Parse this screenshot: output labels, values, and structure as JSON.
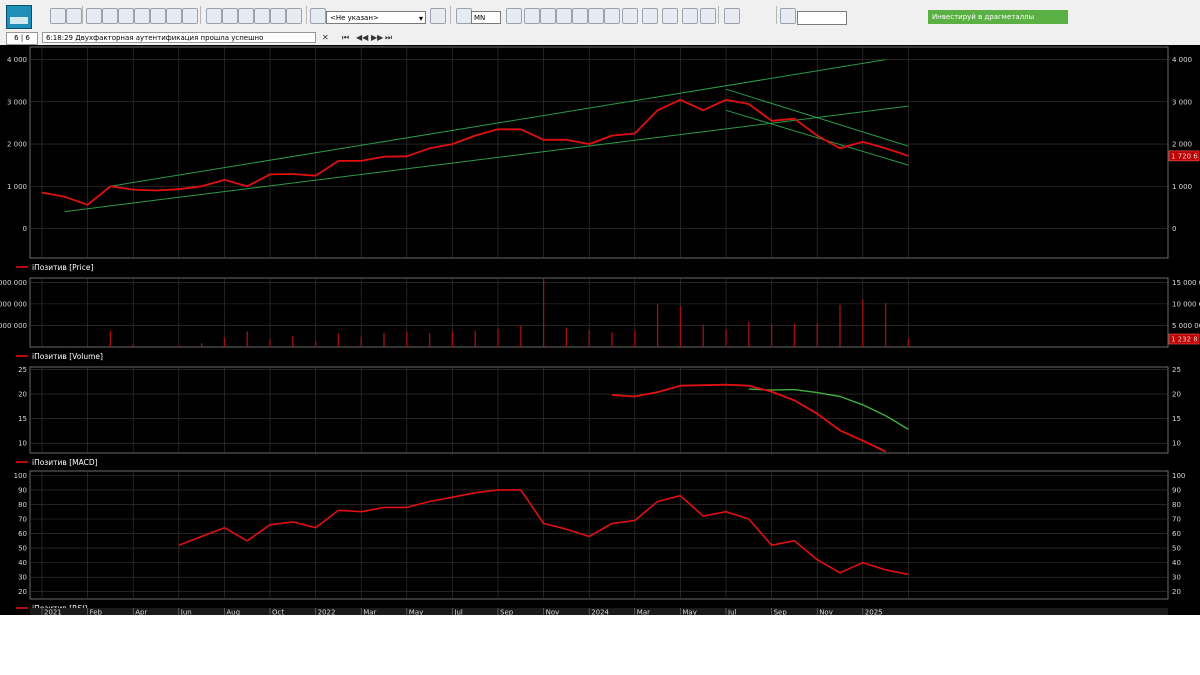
{
  "toolbar": {
    "strategy_value": "<Не указан>",
    "timeframe_value": "MN",
    "promo_label": "Инвестируй в драгметаллы"
  },
  "status": {
    "counter": "6 | 6",
    "time": "6:18:29",
    "message": "Двухфакторная аутентификация прошла успешно"
  },
  "icons": [
    "app-logo-icon",
    "cursor-icon",
    "crosshair-icon",
    "zoom-icon",
    "magnet-icon",
    "trend-line-icon",
    "text-icon",
    "search-icon"
  ],
  "colors": {
    "price": "#e01010",
    "signal": "#40b040",
    "trend": "#2a9a4a",
    "grid": "#3a3a3a",
    "label_bg": "#c00000"
  },
  "chart_data": [
    {
      "type": "line",
      "pane": "price",
      "legend": "iПозитив [Price]",
      "yticks": [
        "0",
        "1 000",
        "2 000",
        "3 000",
        "4 000"
      ],
      "ylim": [
        -700,
        4300
      ],
      "last_value_label": "1 720 6",
      "x": [
        0,
        1,
        2,
        3,
        4,
        5,
        6,
        7,
        8,
        9,
        10,
        11,
        12,
        13,
        14,
        15,
        16,
        17,
        18,
        19,
        20,
        21,
        22,
        23,
        24,
        25,
        26,
        27,
        28,
        29,
        30,
        31,
        32,
        33,
        34,
        35,
        36,
        37,
        38
      ],
      "values": [
        850,
        750,
        560,
        1000,
        920,
        900,
        930,
        1000,
        1150,
        1000,
        1280,
        1290,
        1250,
        1600,
        1600,
        1700,
        1710,
        1900,
        2000,
        2200,
        2350,
        2350,
        2100,
        2100,
        2000,
        2200,
        2250,
        2800,
        3050,
        2800,
        3050,
        2950,
        2550,
        2600,
        2200,
        1900,
        2050,
        1900,
        1720
      ],
      "trendlines": [
        {
          "from": [
            3,
            1000
          ],
          "to": [
            37,
            4000
          ]
        },
        {
          "from": [
            1,
            400
          ],
          "to": [
            38,
            2900
          ]
        },
        {
          "from": [
            30,
            3300
          ],
          "to": [
            38,
            1950
          ]
        },
        {
          "from": [
            30,
            2800
          ],
          "to": [
            38,
            1500
          ]
        }
      ]
    },
    {
      "type": "bar",
      "pane": "volume",
      "legend": "iПозитив [Volume]",
      "yticks_left": [
        "000 000",
        "000 000",
        "000 000"
      ],
      "yticks_right": [
        "5 000 00",
        "10 000 0",
        "15 000 0"
      ],
      "ylim": [
        0,
        16000000
      ],
      "last_value_label": "1 232 8",
      "x": [
        0,
        1,
        2,
        3,
        4,
        5,
        6,
        7,
        8,
        9,
        10,
        11,
        12,
        13,
        14,
        15,
        16,
        17,
        18,
        19,
        20,
        21,
        22,
        23,
        24,
        25,
        26,
        27,
        28,
        29,
        30,
        31,
        32,
        33,
        34,
        35,
        36,
        37,
        38
      ],
      "values": [
        200000,
        100000,
        300000,
        3800000,
        600000,
        200000,
        300000,
        900000,
        2200000,
        3600000,
        1800000,
        2600000,
        1400000,
        3200000,
        2400000,
        3300000,
        3500000,
        3200000,
        3600000,
        3800000,
        4200000,
        5000000,
        16000000,
        4500000,
        3900000,
        3400000,
        3800000,
        10000000,
        9500000,
        5200000,
        4000000,
        5800000,
        5200000,
        5400000,
        5500000,
        9800000,
        11000000,
        10200000,
        2000000
      ]
    },
    {
      "type": "line",
      "pane": "macd",
      "legend": "iПозитив [MACD]",
      "yticks": [
        "10",
        "15",
        "20",
        "25"
      ],
      "ylim": [
        8,
        25.5
      ],
      "series": [
        {
          "x": [
            25,
            26,
            27,
            28,
            29,
            30,
            31,
            32,
            33,
            34,
            35,
            36,
            37
          ],
          "values": [
            19.8,
            19.5,
            20.4,
            21.7,
            21.8,
            21.9,
            21.7,
            20.5,
            18.7,
            16.0,
            12.6,
            10.5,
            8.3
          ]
        },
        {
          "x": [
            31,
            32,
            33,
            34,
            35,
            36,
            37,
            38
          ],
          "values": [
            21.0,
            20.8,
            20.9,
            20.3,
            19.5,
            17.8,
            15.6,
            12.8
          ]
        }
      ]
    },
    {
      "type": "line",
      "pane": "rsi",
      "legend": "iПозитив [RSI]",
      "yticks": [
        "20",
        "30",
        "40",
        "50",
        "60",
        "70",
        "80",
        "90",
        "100"
      ],
      "ylim": [
        15,
        103
      ],
      "x": [
        6,
        7,
        8,
        9,
        10,
        11,
        12,
        13,
        14,
        15,
        16,
        17,
        18,
        19,
        20,
        21,
        22,
        23,
        24,
        25,
        26,
        27,
        28,
        29,
        30,
        31,
        32,
        33,
        34,
        35,
        36,
        37,
        38
      ],
      "values": [
        52,
        58,
        64,
        55,
        66,
        68,
        64,
        76,
        75,
        78,
        78,
        82,
        85,
        88,
        90,
        90,
        67,
        63,
        58,
        67,
        69,
        82,
        86,
        72,
        75,
        70,
        52,
        55,
        42,
        33,
        40,
        35,
        32
      ],
      "xticks": [
        "2021",
        "Feb",
        "Apr",
        "Jun",
        "Aug",
        "Oct",
        "2022",
        "Mar",
        "May",
        "Jul",
        "Sep",
        "Nov",
        "2024",
        "Mar",
        "May",
        "Jul",
        "Sep",
        "Nov",
        "2025"
      ]
    }
  ]
}
